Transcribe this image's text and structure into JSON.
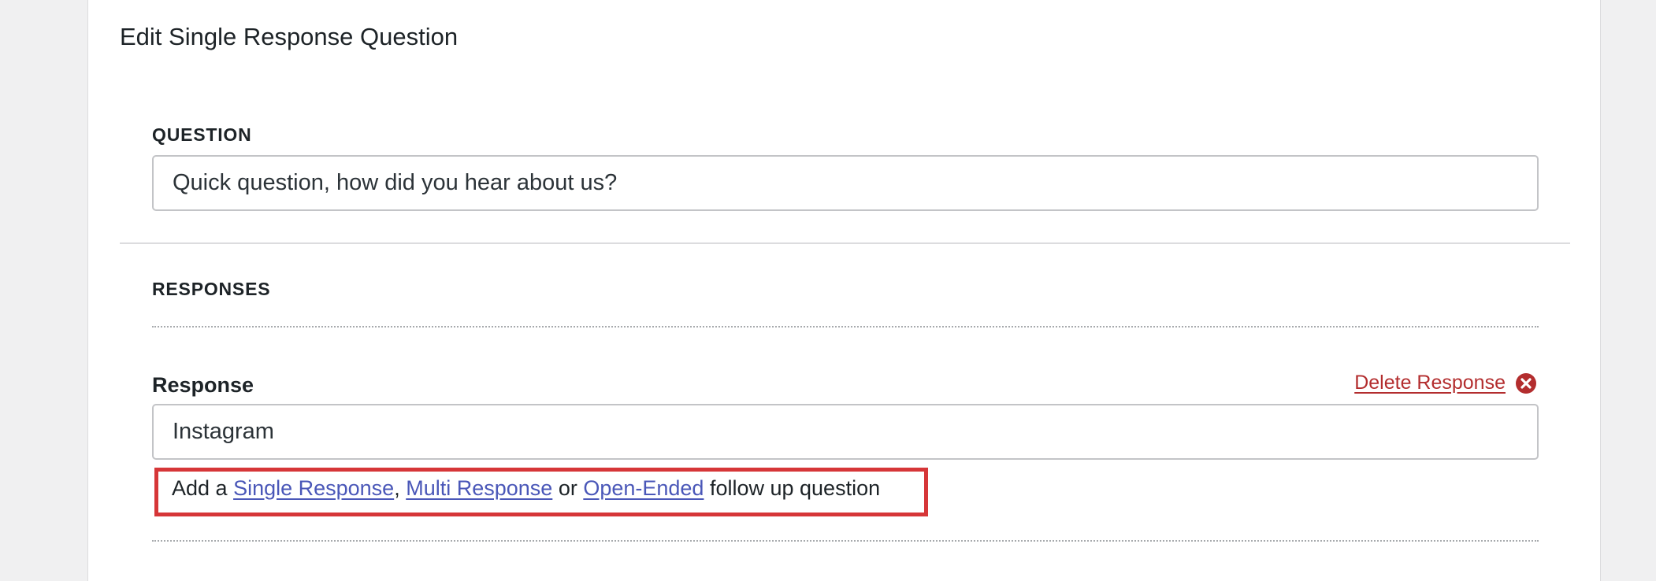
{
  "page": {
    "title": "Edit Single Response Question"
  },
  "question": {
    "label": "QUESTION",
    "value": "Quick question, how did you hear about us?"
  },
  "responses": {
    "label": "RESPONSES",
    "items": [
      {
        "label": "Response",
        "value": "Instagram",
        "delete_label": "Delete Response",
        "delete_icon": "close-circle-icon"
      }
    ]
  },
  "followup": {
    "prefix": "Add a ",
    "single_label": "Single Response",
    "sep1": ", ",
    "multi_label": "Multi Response",
    "sep2": " or ",
    "open_label": "Open-Ended",
    "suffix": " follow up question"
  },
  "colors": {
    "link": "#4a57b8",
    "danger": "#b32d2e",
    "highlight_border": "#d63638"
  }
}
